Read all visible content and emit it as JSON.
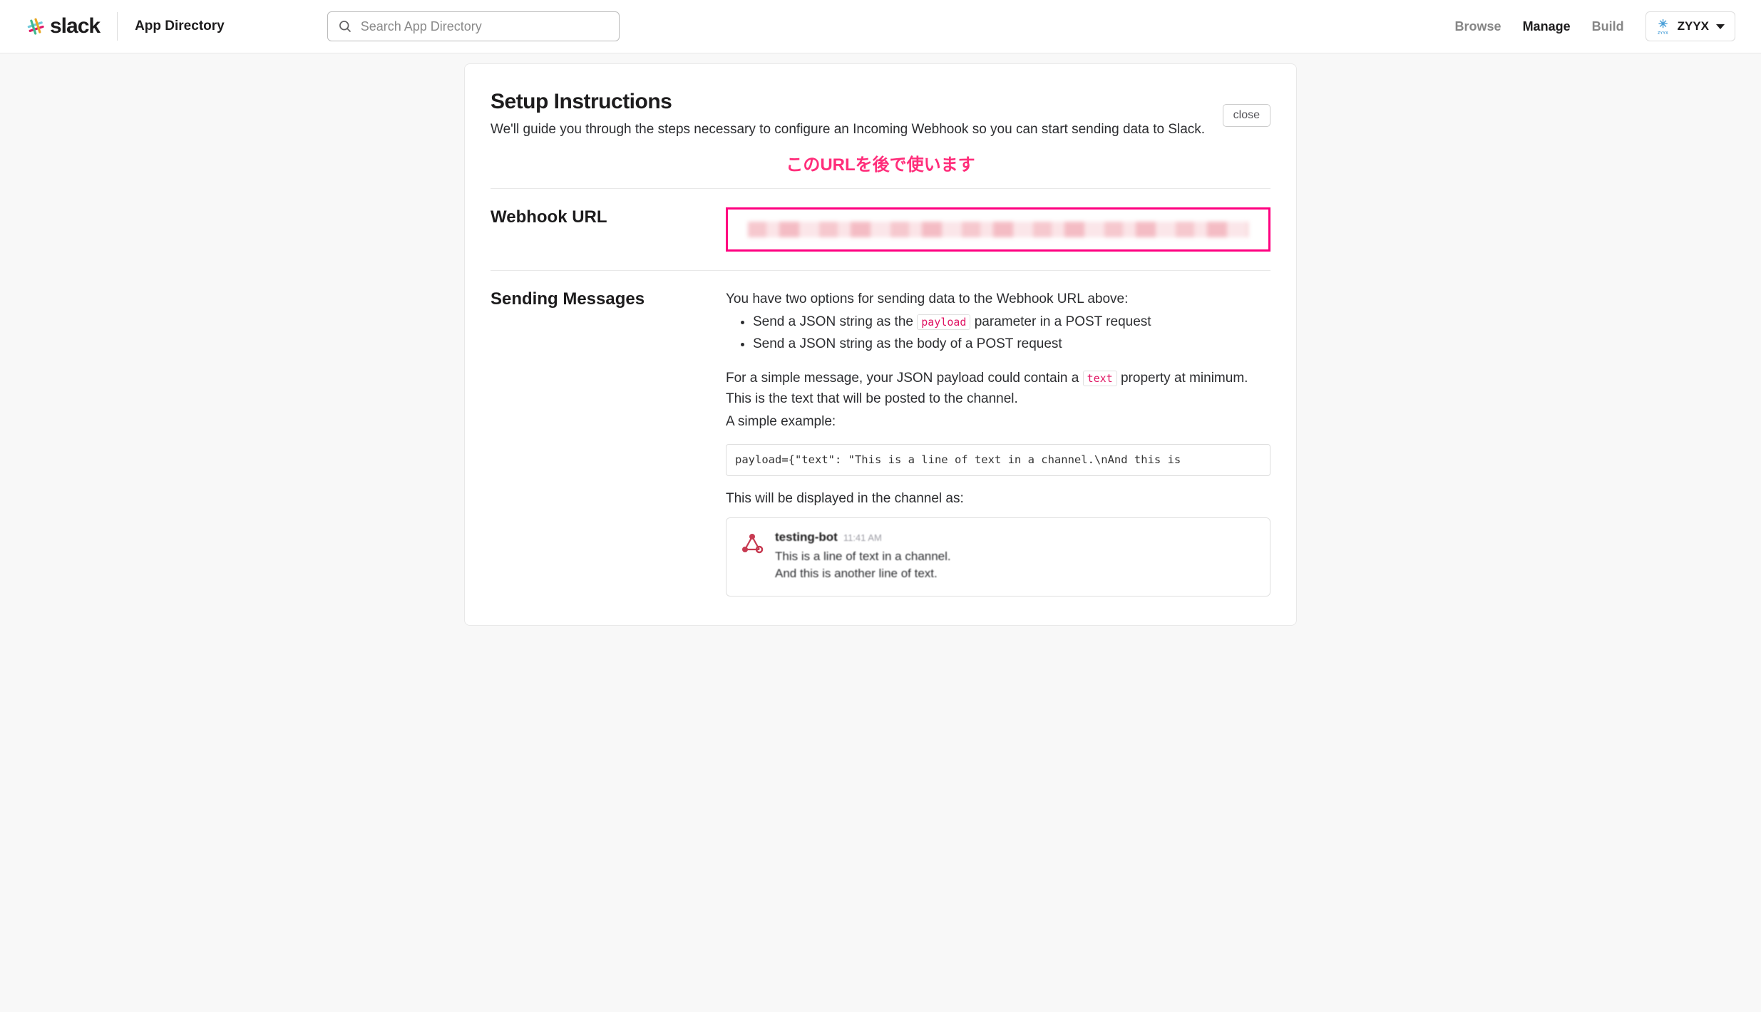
{
  "header": {
    "brand": "slack",
    "title": "App Directory",
    "search_placeholder": "Search App Directory",
    "nav": {
      "browse": "Browse",
      "manage": "Manage",
      "build": "Build"
    },
    "workspace": {
      "name": "ZYYX",
      "sub": "ZYYX"
    }
  },
  "page": {
    "title": "Setup Instructions",
    "subtitle": "We'll guide you through the steps necessary to configure an Incoming Webhook so you can start sending data to Slack.",
    "close": "close",
    "annotation": "このURLを後で使います",
    "webhook": {
      "label": "Webhook URL"
    },
    "sending": {
      "label": "Sending Messages",
      "intro": "You have two options for sending data to the Webhook URL above:",
      "opt1a": "Send a JSON string as the ",
      "opt1_code": "payload",
      "opt1b": " parameter in a POST request",
      "opt2": "Send a JSON string as the body of a POST request",
      "para2a": "For a simple message, your JSON payload could contain a ",
      "para2_code": "text",
      "para2b": " property at minimum. This is the text that will be posted to the channel.",
      "para3": "A simple example:",
      "code": "payload={\"text\": \"This is a line of text in a channel.\\nAnd this is ",
      "para4": "This will be displayed in the channel as:",
      "preview": {
        "bot": "testing-bot",
        "time": "11:41 AM",
        "line1": "This is a line of text in a channel.",
        "line2": "And this is another line of text."
      }
    }
  }
}
